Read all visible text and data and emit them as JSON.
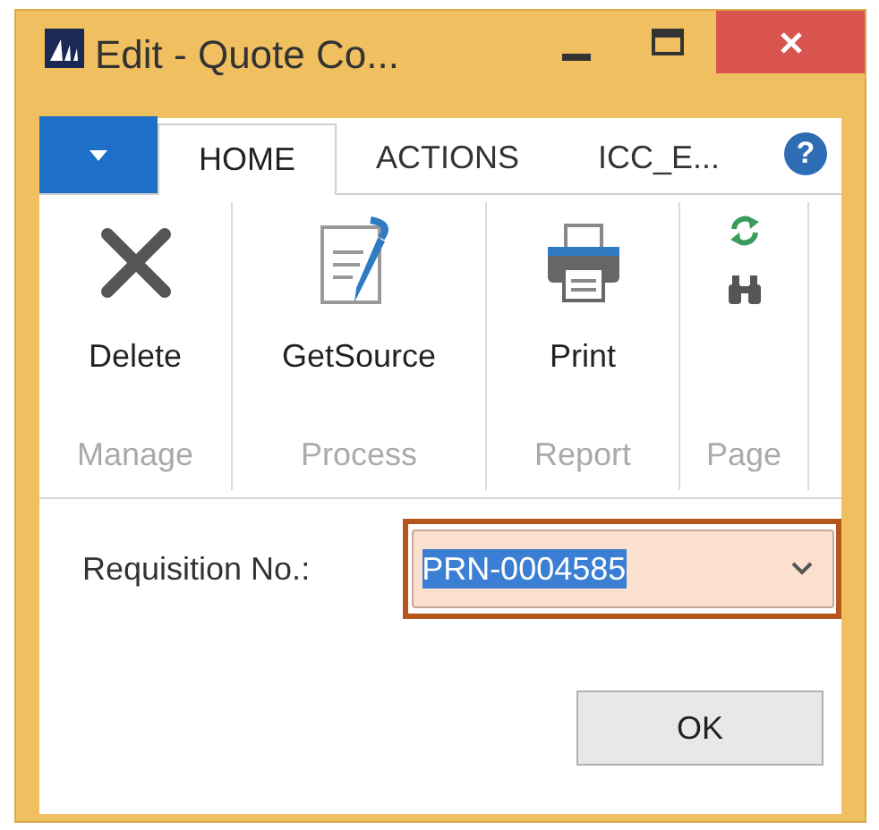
{
  "window": {
    "title": "Edit - Quote Co..."
  },
  "tabs": [
    {
      "label": "HOME",
      "selected": true
    },
    {
      "label": "ACTIONS",
      "selected": false
    },
    {
      "label": "ICC_E...",
      "selected": false
    }
  ],
  "help_button": "?",
  "ribbon_groups": [
    {
      "label": "Manage",
      "actions": [
        {
          "kind": "delete",
          "label": "Delete"
        }
      ]
    },
    {
      "label": "Process",
      "actions": [
        {
          "kind": "getsource",
          "label": "GetSource"
        }
      ]
    },
    {
      "label": "Report",
      "actions": [
        {
          "kind": "print",
          "label": "Print"
        }
      ]
    },
    {
      "label": "Page",
      "actions": [
        {
          "kind": "refresh"
        },
        {
          "kind": "find"
        }
      ]
    }
  ],
  "form": {
    "label": "Requisition No.:",
    "value": "PRN-0004585",
    "highlighted": true
  },
  "buttons": [
    "OK"
  ]
}
